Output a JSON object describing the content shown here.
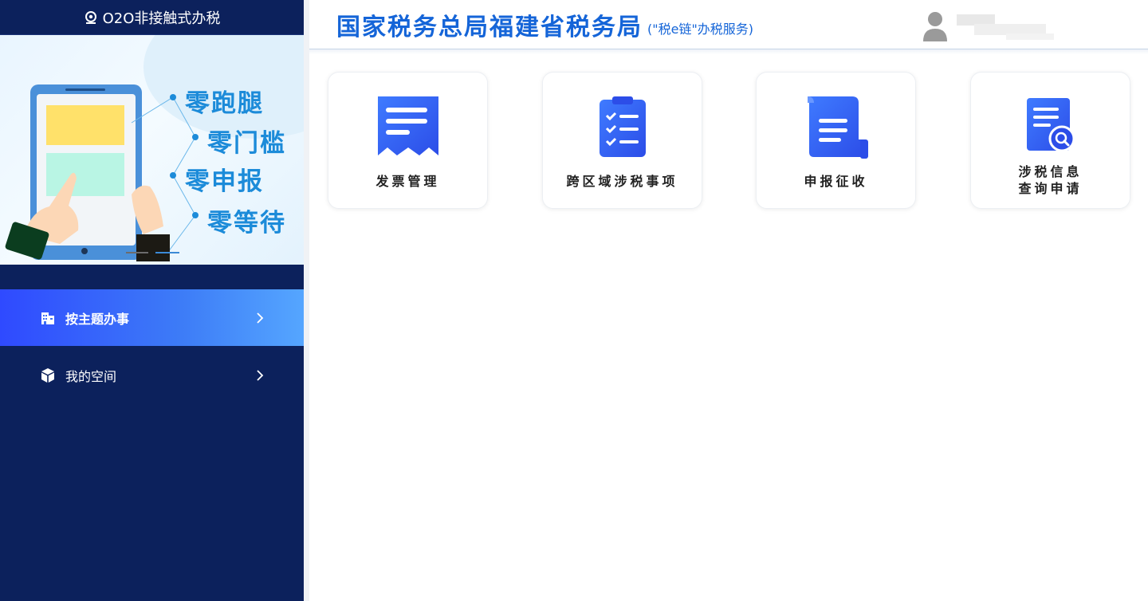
{
  "sidebar": {
    "header_title": "O2O非接触式办税",
    "banner_slogans": [
      "零跑腿",
      "零门槛",
      "零申报",
      "零等待"
    ],
    "nav": [
      {
        "label": "按主题办事",
        "icon": "building-icon",
        "active": true
      },
      {
        "label": "我的空间",
        "icon": "cube-icon",
        "active": false
      }
    ]
  },
  "header": {
    "title": "国家税务总局福建省税务局",
    "subtitle": "(\"税e链\"办税服务)",
    "user_avatar": "user-avatar-icon"
  },
  "cards": [
    {
      "label": "发票管理",
      "icon": "invoice-receipt-icon"
    },
    {
      "label": "跨区域涉税事项",
      "icon": "clipboard-checklist-icon"
    },
    {
      "label": "申报征收",
      "icon": "scroll-document-icon"
    },
    {
      "label_line1": "涉税信息",
      "label_line2": "查询申请",
      "icon": "document-search-icon"
    }
  ],
  "colors": {
    "sidebar_bg": "#0c215c",
    "accent": "#1565d8",
    "active_nav_start": "#2f4aff",
    "active_nav_end": "#55a6ff"
  }
}
